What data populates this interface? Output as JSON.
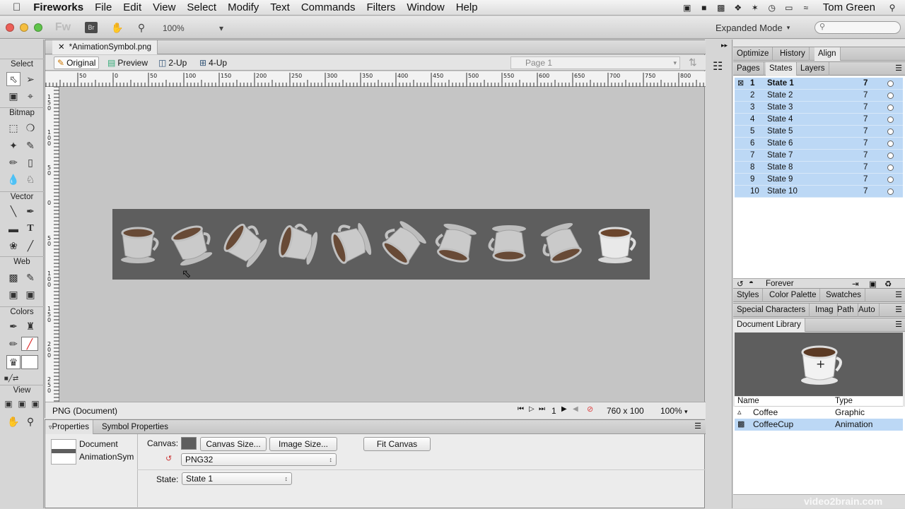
{
  "menubar": {
    "apple": "",
    "app_name": "Fireworks",
    "items": [
      "File",
      "Edit",
      "View",
      "Select",
      "Modify",
      "Text",
      "Commands",
      "Filters",
      "Window",
      "Help"
    ],
    "user": "Tom Green"
  },
  "toolbar": {
    "fw_logo": "Fw",
    "br_logo": "Br",
    "zoom": "100%",
    "workspace": "Expanded Mode",
    "search_placeholder": ""
  },
  "tools": {
    "sections": [
      "Select",
      "Bitmap",
      "Vector",
      "Web",
      "Colors",
      "View"
    ]
  },
  "document": {
    "tab_title": "*AnimationSymbol.png",
    "views": [
      "Original",
      "Preview",
      "2-Up",
      "4-Up"
    ],
    "page": "Page 1",
    "ruler_h": [
      "50",
      "0",
      "50",
      "100",
      "150",
      "200",
      "250",
      "300",
      "350",
      "400",
      "450",
      "500",
      "550",
      "600",
      "650",
      "700",
      "750",
      "800"
    ],
    "ruler_v": [
      "150",
      "100",
      "50",
      "0",
      "50",
      "100",
      "150",
      "200",
      "250"
    ],
    "canvas_color": "#5e5e5e",
    "status_text": "PNG (Document)",
    "frame_number": "1",
    "dimensions": "760 x 100",
    "zoom_status": "100%"
  },
  "properties": {
    "tabs": [
      "Properties",
      "Symbol Properties"
    ],
    "doc_label": "Document",
    "doc_name": "AnimationSym",
    "canvas_label": "Canvas:",
    "canvas_size_btn": "Canvas Size...",
    "image_size_btn": "Image Size...",
    "fit_canvas_btn": "Fit Canvas",
    "format": "PNG32",
    "state_label": "State:",
    "state_value": "State 1"
  },
  "right_panel": {
    "tabs_top": [
      "Optimize",
      "History",
      "Align"
    ],
    "tabs_second": [
      "Pages",
      "States",
      "Layers"
    ],
    "states": [
      {
        "num": "1",
        "name": "State 1",
        "delay": "7"
      },
      {
        "num": "2",
        "name": "State 2",
        "delay": "7"
      },
      {
        "num": "3",
        "name": "State 3",
        "delay": "7"
      },
      {
        "num": "4",
        "name": "State 4",
        "delay": "7"
      },
      {
        "num": "5",
        "name": "State 5",
        "delay": "7"
      },
      {
        "num": "6",
        "name": "State 6",
        "delay": "7"
      },
      {
        "num": "7",
        "name": "State 7",
        "delay": "7"
      },
      {
        "num": "8",
        "name": "State 8",
        "delay": "7"
      },
      {
        "num": "9",
        "name": "State 9",
        "delay": "7"
      },
      {
        "num": "10",
        "name": "State 10",
        "delay": "7"
      }
    ],
    "loop": "Forever",
    "tabs_styles": [
      "Styles",
      "Color Palette",
      "Swatches"
    ],
    "tabs_special": [
      "Special Characters",
      "Imag",
      "Path",
      "Auto"
    ],
    "library_tab": "Document Library",
    "library_cols": [
      "Name",
      "Type"
    ],
    "library_items": [
      {
        "name": "Coffee",
        "type": "Graphic"
      },
      {
        "name": "CoffeeCup",
        "type": "Animation"
      }
    ]
  },
  "watermark": "video2brain.com",
  "colors": {
    "selection": "#bcd8f5",
    "canvas": "#5e5e5e",
    "pasteboard": "#c5c5c5"
  }
}
